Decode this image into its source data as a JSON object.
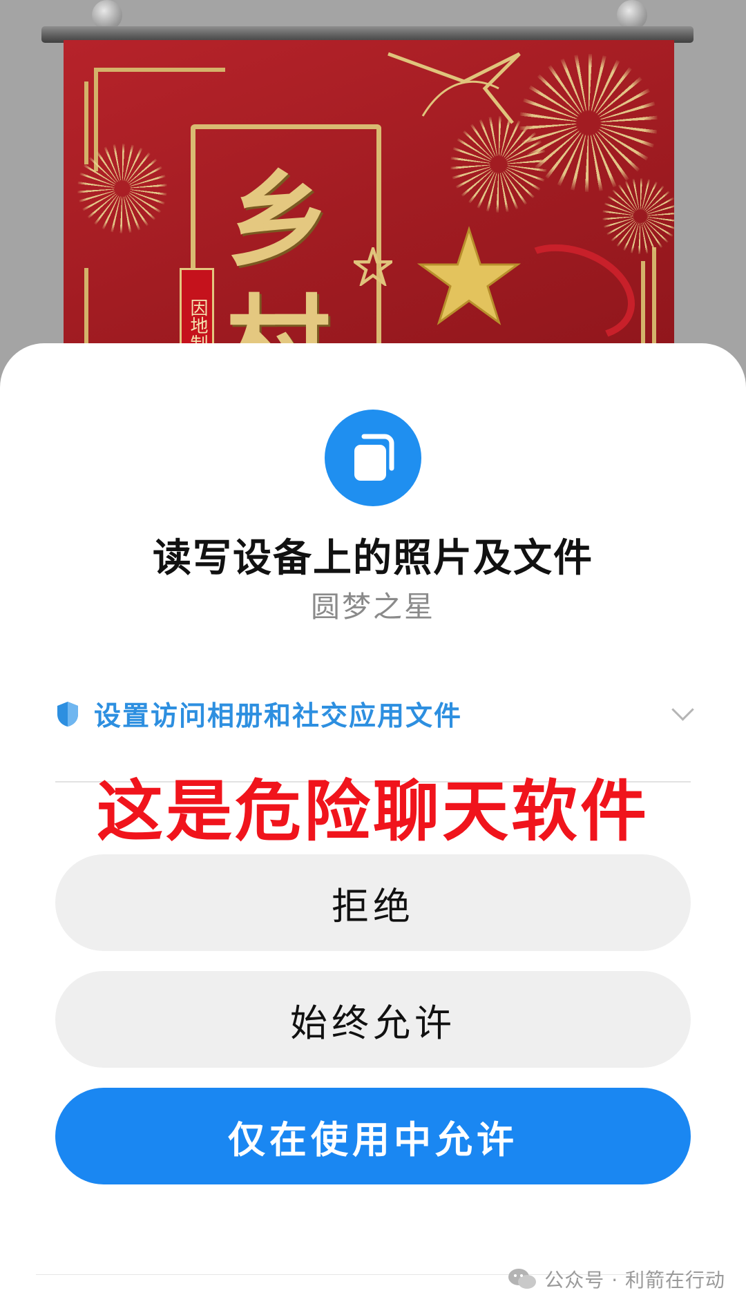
{
  "permission": {
    "title": "读写设备上的照片及文件",
    "app_name": "圆梦之星",
    "option_label": "设置访问相册和社交应用文件",
    "icon": "file-copy-icon"
  },
  "overlay_warning": "这是危险聊天软件",
  "buttons": {
    "deny": "拒绝",
    "always_allow": "始终允许",
    "allow_while_in_use": "仅在使用中允许"
  },
  "background_banner": {
    "chars": [
      "乡",
      "村"
    ],
    "tag": "因地制"
  },
  "watermark": "公众号 · 利箭在行动",
  "colors": {
    "primary_blue": "#1a87f2",
    "warning_red": "#f0141c",
    "banner_red": "#a01c22",
    "gold": "#d9bb72"
  }
}
